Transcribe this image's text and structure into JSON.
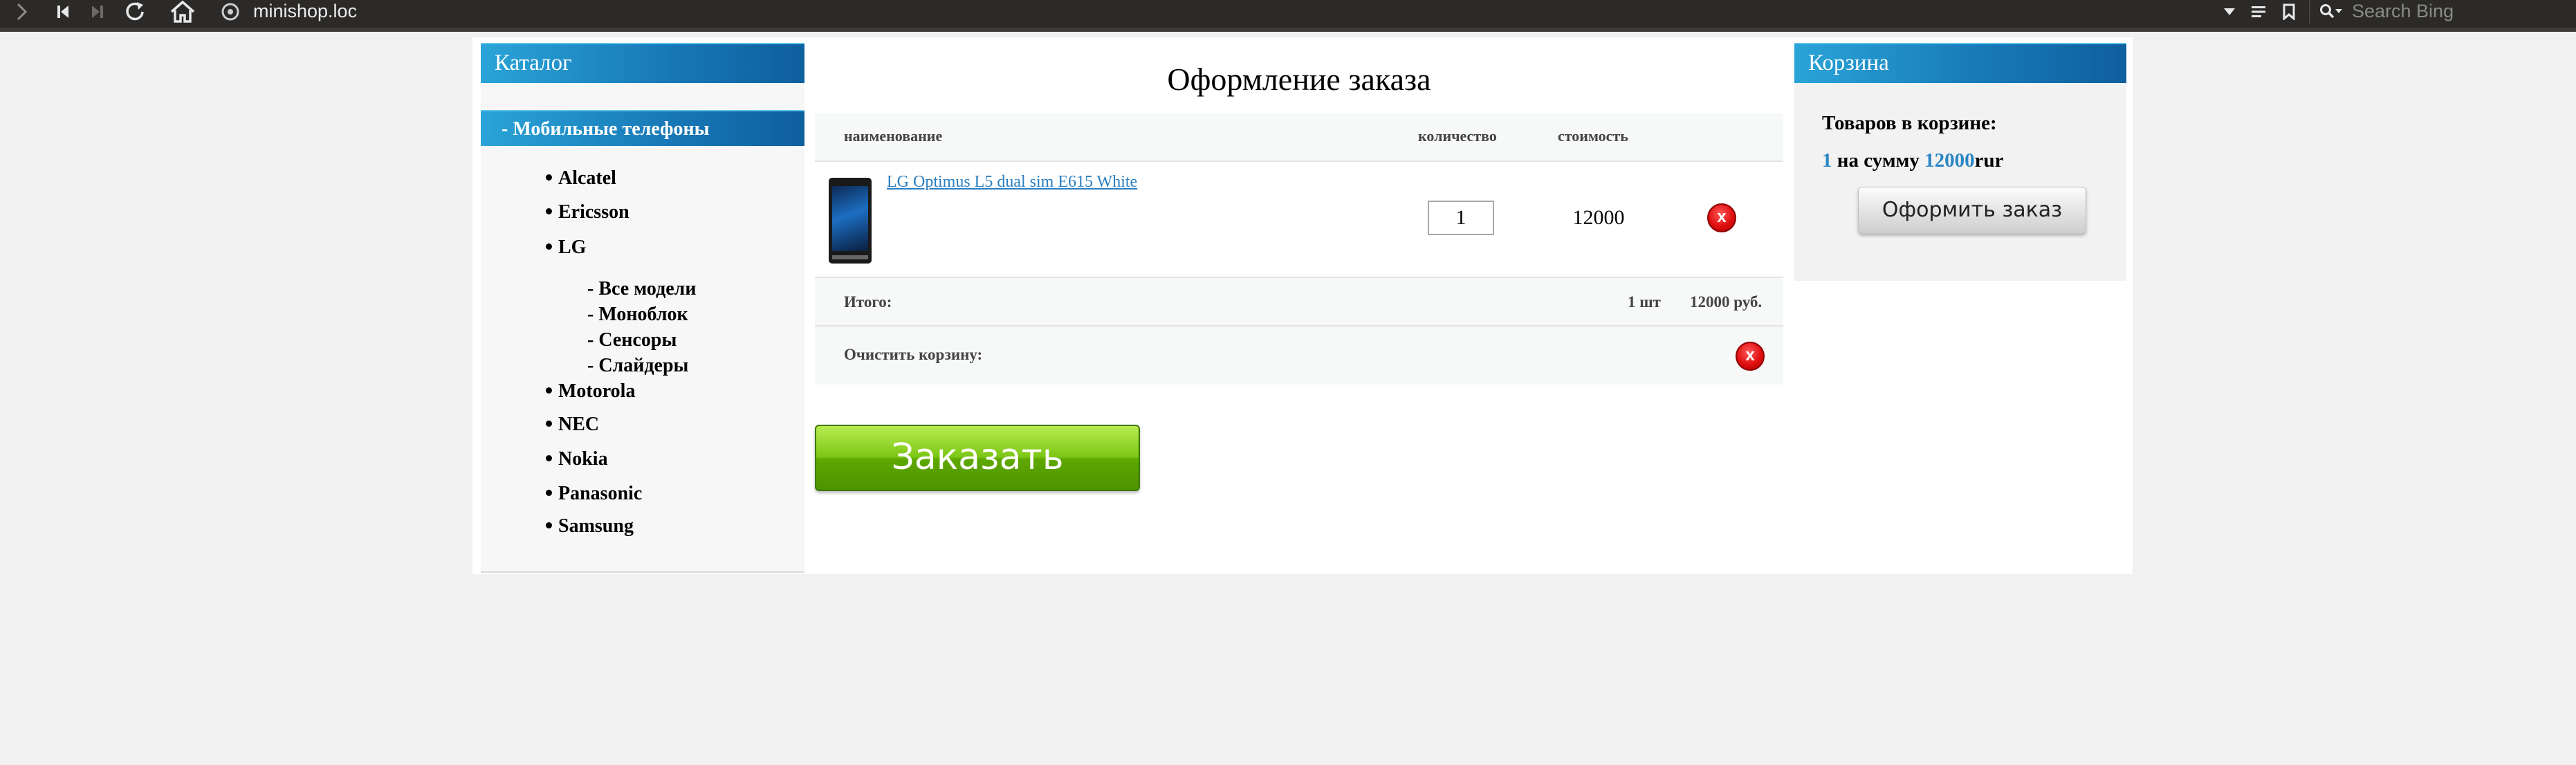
{
  "browser": {
    "url": "minishop.loc",
    "search_placeholder": "Search Bing",
    "icons": [
      "forward-icon",
      "first-icon",
      "last-icon",
      "reload-icon",
      "home-icon",
      "site-info-icon",
      "dropdown-icon",
      "reader-icon",
      "bookmark-icon",
      "search-icon"
    ]
  },
  "sidebar": {
    "title": "Каталог",
    "active_category": "- Мобильные телефоны",
    "brands": [
      "Alcatel",
      "Ericsson",
      "LG",
      "Motorola",
      "NEC",
      "Nokia",
      "Panasonic",
      "Samsung"
    ],
    "lg_subitems": [
      "- Все модели",
      "- Моноблок",
      "- Сенсоры",
      "- Слайдеры"
    ]
  },
  "main": {
    "title": "Оформление заказа",
    "columns": {
      "name": "наименование",
      "quantity": "количество",
      "cost": "стоимость"
    },
    "items": [
      {
        "name": "LG Optimus L5 dual sim E615 White",
        "quantity": "1",
        "cost": "12000",
        "delete_label": "x"
      }
    ],
    "total_label": "Итого:",
    "total_qty": "1 шт",
    "total_sum": "12000 руб.",
    "clear_label": "Очистить корзину:",
    "clear_button": "x",
    "order_button": "Заказать"
  },
  "cart": {
    "title": "Корзина",
    "items_label": "Товаров в корзине:",
    "count": "1",
    "sum_label": "на сумму",
    "sum": "12000",
    "currency": "rur",
    "order_button": "Оформить заказ"
  },
  "colors": {
    "accent": "#1777b6",
    "link": "#2a7fc1",
    "delete": "#e00f0f",
    "order_green": "#7dc715",
    "toolbar": "#2b2a28"
  }
}
